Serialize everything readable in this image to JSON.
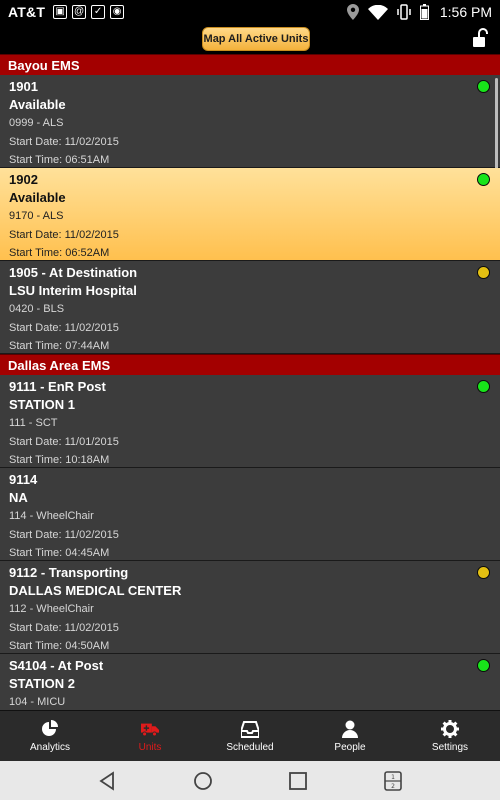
{
  "status_bar": {
    "carrier": "AT&T",
    "time": "1:56 PM",
    "icons": [
      "photo-icon",
      "at-icon",
      "checkbox-icon",
      "camera-icon",
      "location-icon",
      "wifi-icon",
      "vibrate-icon",
      "battery-icon"
    ]
  },
  "action_bar": {
    "map_button_label": "Map All Active Units",
    "lock_icon": "unlock-icon"
  },
  "groups": [
    {
      "name": "Bayou EMS",
      "units": [
        {
          "line1": "1901",
          "line2": "Available",
          "line3": "0999 - ALS",
          "line4": "Start Date: 11/02/2015",
          "line5": "Start Time: 06:51AM",
          "status_color": "green",
          "selected": false
        },
        {
          "line1": "1902",
          "line2": "Available",
          "line3": "9170 - ALS",
          "line4": "Start Date: 11/02/2015",
          "line5": "Start Time: 06:52AM",
          "status_color": "green",
          "selected": true
        },
        {
          "line1": "1905 - At Destination",
          "line2": "LSU Interim Hospital",
          "line3": "0420 - BLS",
          "line4": "Start Date: 11/02/2015",
          "line5": "Start Time: 07:44AM",
          "status_color": "yellow",
          "selected": false
        }
      ]
    },
    {
      "name": "Dallas Area EMS",
      "units": [
        {
          "line1": "9111 - EnR Post",
          "line2": "STATION 1",
          "line3": "111 - SCT",
          "line4": "Start Date: 11/01/2015",
          "line5": "Start Time: 10:18AM",
          "status_color": "green",
          "selected": false
        },
        {
          "line1": "9114",
          "line2": "NA",
          "line3": "114 - WheelChair",
          "line4": "Start Date: 11/02/2015",
          "line5": "Start Time: 04:45AM",
          "status_color": "none",
          "selected": false
        },
        {
          "line1": "9112 - Transporting",
          "line2": "DALLAS MEDICAL CENTER",
          "line3": "112 - WheelChair",
          "line4": "Start Date: 11/02/2015",
          "line5": "Start Time: 04:50AM",
          "status_color": "yellow",
          "selected": false
        },
        {
          "line1": "S4104 - At Post",
          "line2": "STATION 2",
          "line3": "104 - MICU",
          "line4": "",
          "line5": "",
          "status_color": "green",
          "selected": false
        }
      ]
    }
  ],
  "colors": {
    "section_header": "#a30000",
    "selected_row": "#ffc04e",
    "status_green": "#18e51a",
    "status_yellow": "#e4c012",
    "active_tab": "#e01b1b"
  },
  "tabs": [
    {
      "label": "Analytics",
      "icon": "pie-chart-icon",
      "active": false
    },
    {
      "label": "Units",
      "icon": "ambulance-icon",
      "active": true
    },
    {
      "label": "Scheduled",
      "icon": "inbox-icon",
      "active": false
    },
    {
      "label": "People",
      "icon": "person-icon",
      "active": false
    },
    {
      "label": "Settings",
      "icon": "gear-icon",
      "active": false
    }
  ],
  "nav_bar": {
    "icons": [
      "back-icon",
      "home-icon",
      "recents-icon",
      "dual-window-icon"
    ],
    "dual_window_text": "1\n2"
  }
}
